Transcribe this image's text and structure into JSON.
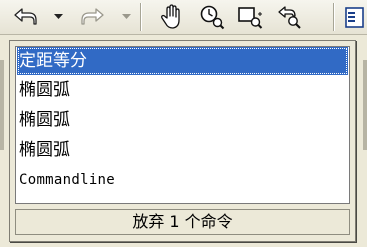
{
  "toolbar": {
    "buttons": [
      {
        "name": "undo-button",
        "icon": "undo-arrow-icon"
      },
      {
        "name": "undo-dropdown-button",
        "icon": "dropdown-arrow-icon"
      },
      {
        "name": "redo-button",
        "icon": "redo-arrow-icon"
      },
      {
        "name": "redo-dropdown-button",
        "icon": "dropdown-arrow-icon"
      },
      {
        "name": "pan-button",
        "icon": "hand-icon"
      },
      {
        "name": "zoom-realtime-button",
        "icon": "zoom-clock-icon"
      },
      {
        "name": "zoom-window-button",
        "icon": "zoom-window-icon"
      },
      {
        "name": "zoom-previous-button",
        "icon": "zoom-previous-icon"
      },
      {
        "name": "properties-button",
        "icon": "properties-icon"
      }
    ]
  },
  "undo_list": {
    "items": [
      "定距等分",
      "椭圆弧",
      "椭圆弧",
      "椭圆弧",
      "Commandline"
    ],
    "selected_index": 0
  },
  "status": {
    "text": "放弃 1 个命令"
  },
  "colors": {
    "selection": "#316ac5",
    "panel_bg": "#ece9d8",
    "list_bg": "#ffffff"
  }
}
